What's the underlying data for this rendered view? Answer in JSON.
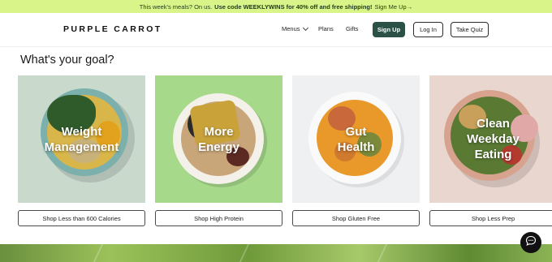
{
  "promo": {
    "lead": "This week's meals? On us.",
    "offer": "Use code WEEKLYWINS for 40% off and free shipping!",
    "cta": "Sign Me Up→"
  },
  "header": {
    "logo": "PURPLE CARROT",
    "nav": {
      "menus": "Menus",
      "plans": "Plans",
      "gifts": "Gifts"
    },
    "signup": "Sign Up",
    "login": "Log In",
    "quiz": "Take Quiz"
  },
  "goals": {
    "title": "What's your goal?",
    "cards": [
      {
        "label_line1": "Weight",
        "label_line2": "Management",
        "label_line3": "",
        "button": "Shop Less than 600 Calories",
        "bg": "#c9d9cc"
      },
      {
        "label_line1": "More",
        "label_line2": "Energy",
        "label_line3": "",
        "button": "Shop High Protein",
        "bg": "#a6d98a"
      },
      {
        "label_line1": "Gut",
        "label_line2": "Health",
        "label_line3": "",
        "button": "Shop Gluten Free",
        "bg": "#eef0f2"
      },
      {
        "label_line1": "Clean",
        "label_line2": "Weekday",
        "label_line3": "Eating",
        "button": "Shop Less Prep",
        "bg": "#e9d7cf"
      }
    ]
  },
  "chat": {
    "icon": "chat-bubble-icon"
  }
}
